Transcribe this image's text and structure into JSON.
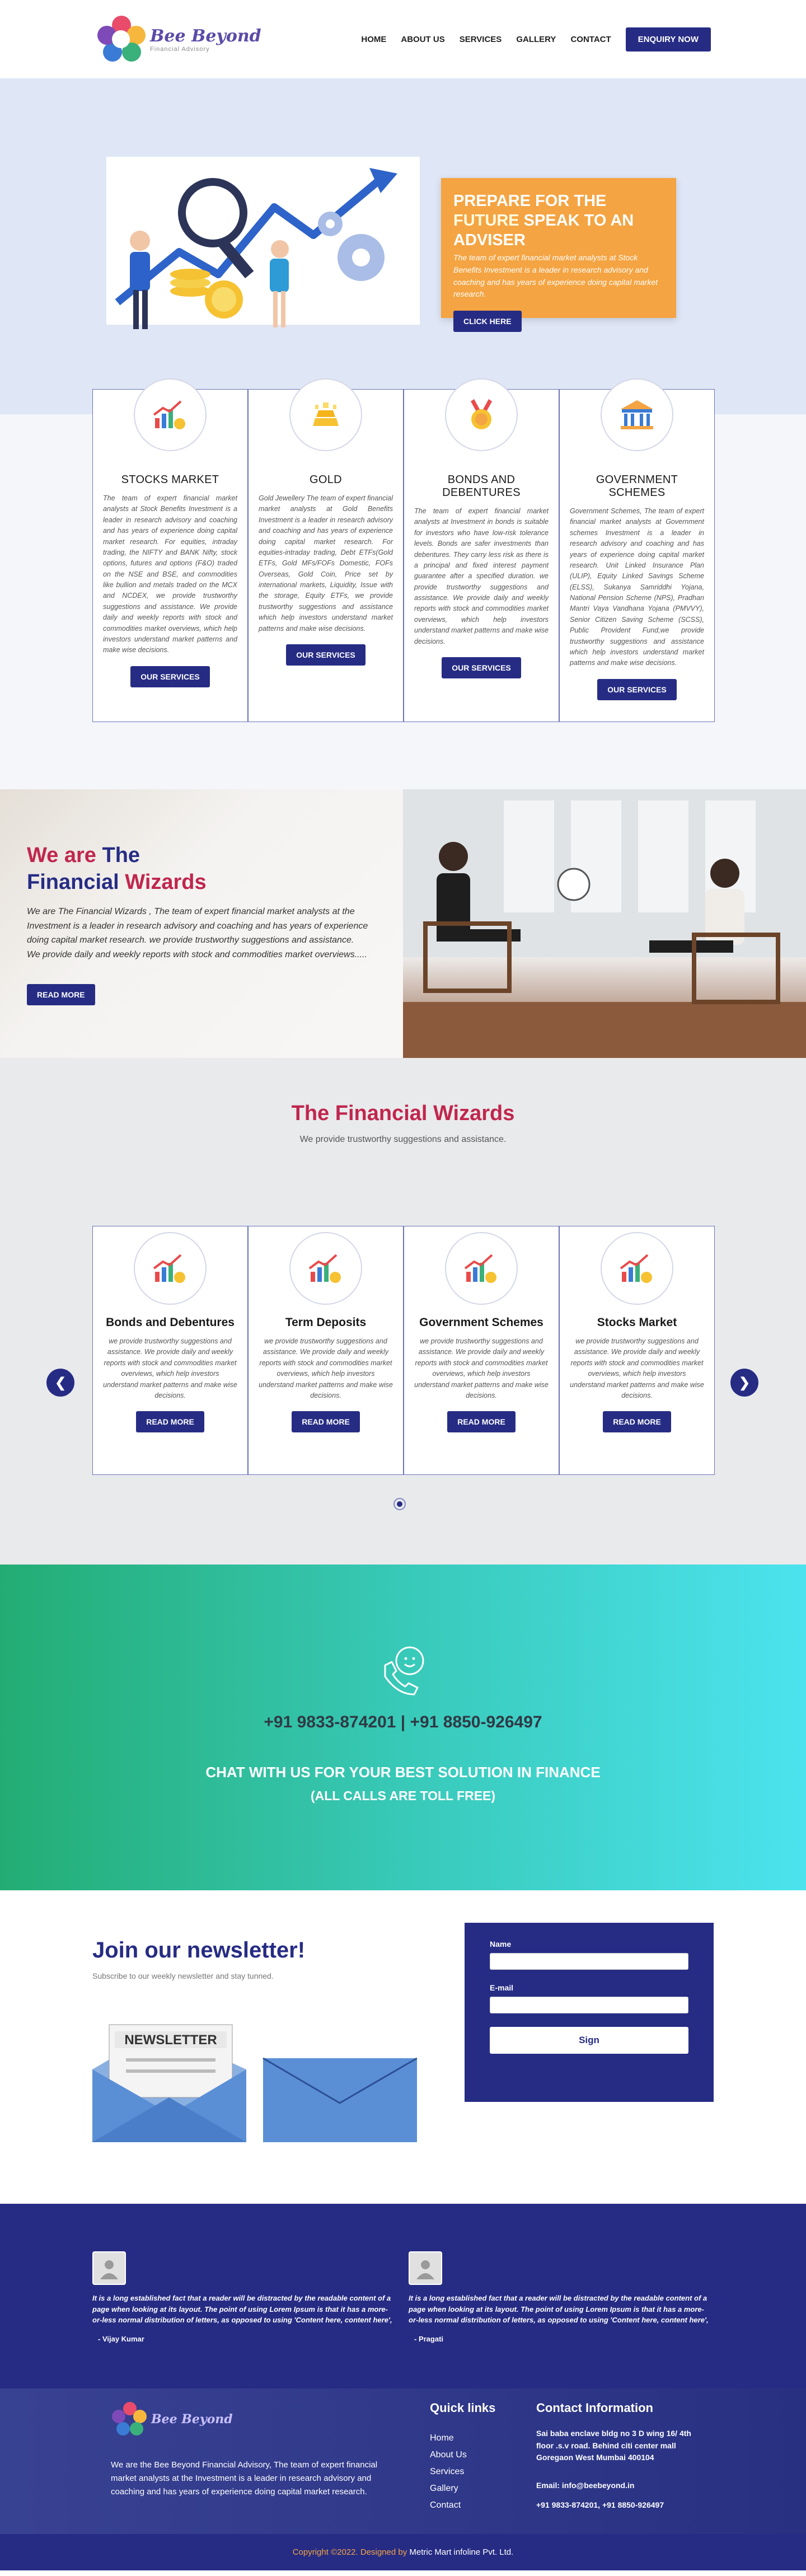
{
  "nav": {
    "logo_name": "Bee Beyond",
    "logo_tag": "Financial Advisory",
    "items": [
      "HOME",
      "ABOUT US",
      "SERVICES",
      "GALLERY",
      "CONTACT"
    ],
    "cta": "ENQUIRY NOW"
  },
  "hero": {
    "title_a": "PREPARE FOR THE ",
    "title_b": "FUTURE",
    "title_c": " SPEAK TO AN ADVISER",
    "subtitle": "The team of expert financial market analysts at Stock Benefits Investment is a leader in research advisory and coaching and has years of experience doing capital market research.",
    "button": "CLICK HERE"
  },
  "services": [
    {
      "title": "STOCKS MARKET",
      "text": "The team of expert financial market analysts at Stock Benefits Investment is a leader in research advisory and coaching and has years of experience doing capital market research. For equities, intraday trading, the NIFTY and BANK Nifty, stock options, futures and options (F&O) traded on the NSE and BSE, and commodities like bullion and metals traded on the MCX and NCDEX, we provide trustworthy suggestions and assistance. We provide daily and weekly reports with stock and commodities market overviews, which help investors understand market patterns and make wise decisions.",
      "button": "OUR SERVICES"
    },
    {
      "title": "GOLD",
      "text": "Gold Jewellery The team of expert financial market analysts at Gold Benefits Investment is a leader in research advisory and coaching and has years of experience doing capital market research. For equities-intraday trading, Debt ETFs(Gold ETFs, Gold MFs/FOFs Domestic, FOFs Overseas, Gold Coin, Price set by international markets, Liquidity, Issue with the storage, Equity ETFs, we provide trustworthy suggestions and assistance which help investors understand market patterns and make wise decisions.",
      "button": "OUR SERVICES"
    },
    {
      "title": "BONDS AND DEBENTURES",
      "text": "The team of expert financial market analysts at Investment in bonds is suitable for investors who have low-risk tolerance levels. Bonds are safer investments than debentures. They carry less risk as there is a principal and fixed interest payment guarantee after a specified duration. we provide trustworthy suggestions and assistance. We provide daily and weekly reports with stock and commodities market overviews, which help investors understand market patterns and make wise decisions.",
      "button": "OUR SERVICES"
    },
    {
      "title": "GOVERNMENT SCHEMES",
      "text": "Government Schemes, The team of expert financial market analysts at Government schemes Investment is a leader in research advisory and coaching and has years of experience doing capital market research. Unit Linked Insurance Plan (ULIP), Equity Linked Savings Scheme (ELSS), Sukanya Samriddhi Yojana, National Pension Scheme (NPS), Pradhan Mantri Vaya Vandhana Yojana (PMVVY), Senior Citizen Saving Scheme (SCSS), Public Provident Fund,we provide trustworthy suggestions and assistance which help investors understand market patterns and make wise decisions.",
      "button": "OUR SERVICES"
    }
  ],
  "about": {
    "title_we": "We are ",
    "title_the": "The",
    "title_fin": "Financial ",
    "title_wiz": "Wizards",
    "text": "We are The Financial Wizards , The team of expert financial market analysts at the Investment is a leader in research advisory and coaching and has years of experience doing capital market research. we provide trustworthy suggestions and assistance. We provide daily and weekly reports with stock and commodities market overviews.....",
    "button": "READ MORE"
  },
  "wizards": {
    "title": "The Financial Wizards",
    "subtitle": "We provide trustworthy suggestions and assistance.",
    "text": "we provide trustworthy suggestions and assistance. We provide daily and weekly reports with stock and commodities market overviews, which help investors understand market patterns and make wise decisions.",
    "button": "READ MORE",
    "cards": [
      "Bonds and Debentures",
      "Term Deposits",
      "Government Schemes",
      "Stocks Market"
    ]
  },
  "chat": {
    "phones": "+91 9833-874201 | +91 8850-926497",
    "headline": "CHAT WITH US FOR YOUR BEST SOLUTION IN FINANCE",
    "sub": "(ALL CALLS ARE TOLL FREE)"
  },
  "newsletter": {
    "title": "Join our newsletter!",
    "subtitle": "Subscribe to our weekly newsletter and stay tunned.",
    "image_label": "NEWSLETTER",
    "name_label": "Name",
    "email_label": "E-mail",
    "button": "Sign"
  },
  "testimonials": [
    {
      "text": "It is a long established fact that a reader will be distracted by the readable content of a page when looking at its layout. The point of using Lorem Ipsum is that it has a more-or-less normal distribution of letters, as opposed to using 'Content here, content here',",
      "name": "- Vijay Kumar"
    },
    {
      "text": "It is a long established fact that a reader will be distracted by the readable content of a page when looking at its layout. The point of using Lorem Ipsum is that it has a more-or-less normal distribution of letters, as opposed to using 'Content here, content here',",
      "name": "- Pragati"
    }
  ],
  "footer": {
    "about": "We are the Bee Beyond Financial Advisory, The team of expert financial market analysts at the Investment is a leader in research advisory and coaching and has years of experience doing capital market research.",
    "links_title": "Quick links",
    "links": [
      "Home",
      "About Us",
      "Services",
      "Gallery",
      "Contact"
    ],
    "contact_title": "Contact Information",
    "address": "Sai baba enclave bldg no 3 D wing 16/ 4th floor .s.v road. Behind citi center mall Goregaon West Mumbai 400104",
    "email": "Email: info@beebeyond.in",
    "phone": "+91 9833-874201, +91 8850-926497",
    "copyright": "Copyright ©2022. Designed by ",
    "designer": "Metric Mart infoline Pvt. Ltd."
  },
  "colors": {
    "primary": "#262c84",
    "accent": "#f4a442",
    "brand_red": "#c0264d",
    "chat_green": "#23ad74",
    "chat_cyan": "#4ce3ee"
  }
}
